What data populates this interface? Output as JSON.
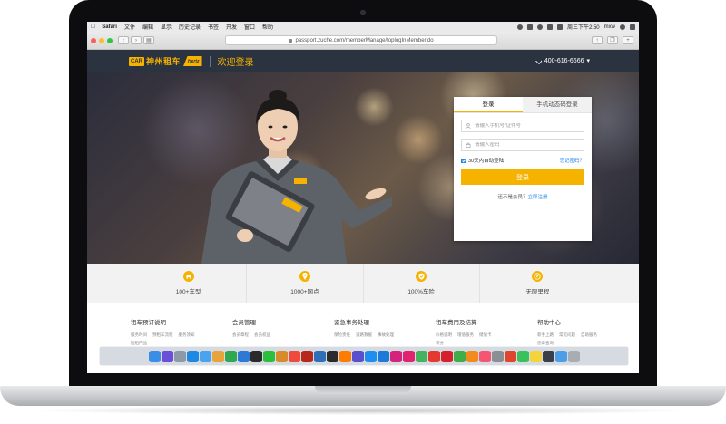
{
  "menubar": {
    "items": [
      "Safari",
      "文件",
      "编辑",
      "显示",
      "历史记录",
      "书签",
      "开发",
      "窗口",
      "帮助"
    ],
    "clock": "周三下午2:50",
    "user": "mxw"
  },
  "browser": {
    "url": "passport.zuche.com/memberManage/toplogInMember.do"
  },
  "header": {
    "logo_mark": "CAR",
    "logo_text": "神州租车",
    "logo_partner": "Hertz",
    "title": "欢迎登录",
    "phone": "400-616-6666"
  },
  "login": {
    "tab_account": "登录",
    "tab_phone": "手机动态码登录",
    "username_placeholder": "请输入手机号/证件号",
    "password_placeholder": "请输入密码",
    "remember_label": "30天内自动登陆",
    "remember_checked": true,
    "forgot_link": "忘记密码？",
    "submit_label": "登录",
    "register_prompt": "还不是会员？",
    "register_link": "立即注册"
  },
  "features": [
    {
      "icon": "car-icon",
      "label": "100+车型"
    },
    {
      "icon": "location-pin-icon",
      "label": "1000+网点"
    },
    {
      "icon": "shield-check-icon",
      "label": "100%车险"
    },
    {
      "icon": "compass-icon",
      "label": "无限里程"
    }
  ],
  "footer": [
    {
      "title": "租车预订说明",
      "links": [
        "服务时间",
        "预租车流程",
        "服务须知",
        "短租产品"
      ]
    },
    {
      "title": "会员管理",
      "links": [
        "会员章程",
        "会员权益"
      ]
    },
    {
      "title": "紧急事务处理",
      "links": [
        "保险责任",
        "道路救援",
        "事故处理"
      ]
    },
    {
      "title": "租车费用及结算",
      "links": [
        "价格说明",
        "增值服务",
        "储值卡",
        "积分"
      ]
    },
    {
      "title": "帮助中心",
      "links": [
        "新手上路",
        "常见问题",
        "自助服务",
        "违章查询"
      ]
    }
  ],
  "dock_apps": [
    {
      "name": "finder",
      "color": "#3a8ee6"
    },
    {
      "name": "siri",
      "color": "#6b4fd8"
    },
    {
      "name": "launchpad",
      "color": "#8d99a6"
    },
    {
      "name": "safari",
      "color": "#1e88e5"
    },
    {
      "name": "mail",
      "color": "#4aa3f0"
    },
    {
      "name": "photos",
      "color": "#e8a33c"
    },
    {
      "name": "numbers",
      "color": "#2fa84f"
    },
    {
      "name": "keynote",
      "color": "#2e78d6"
    },
    {
      "name": "qq",
      "color": "#2b2b2b"
    },
    {
      "name": "wechat",
      "color": "#2dbe3c"
    },
    {
      "name": "preview",
      "color": "#d98b2b"
    },
    {
      "name": "calendar",
      "color": "#f04a3a"
    },
    {
      "name": "filezilla",
      "color": "#b8261c"
    },
    {
      "name": "sourcetree",
      "color": "#2f6fb8"
    },
    {
      "name": "terminal",
      "color": "#2b2b2b"
    },
    {
      "name": "illustrator",
      "color": "#ff7c00"
    },
    {
      "name": "aftereffects",
      "color": "#5a4fcf"
    },
    {
      "name": "appstore",
      "color": "#1f8ef1"
    },
    {
      "name": "photoshop",
      "color": "#1d7ad8"
    },
    {
      "name": "xd",
      "color": "#d3237b"
    },
    {
      "name": "indesign",
      "color": "#e0226f"
    },
    {
      "name": "dreamweaver",
      "color": "#44b35e"
    },
    {
      "name": "wps",
      "color": "#e5392f"
    },
    {
      "name": "flash",
      "color": "#d6202c"
    },
    {
      "name": "maps",
      "color": "#3fae49"
    },
    {
      "name": "pages",
      "color": "#f28a1d"
    },
    {
      "name": "music",
      "color": "#f45572"
    },
    {
      "name": "settings",
      "color": "#8a8f96"
    },
    {
      "name": "chrome",
      "color": "#e0452e"
    },
    {
      "name": "messages",
      "color": "#39c25c"
    },
    {
      "name": "notes",
      "color": "#f5d33c"
    },
    {
      "name": "ps-file",
      "color": "#3a3f48"
    },
    {
      "name": "folder",
      "color": "#4a9fe8"
    },
    {
      "name": "trash",
      "color": "#a8adb3"
    }
  ],
  "colors": {
    "brand_yellow": "#f5b300",
    "header_bg": "#2b3240",
    "link_blue": "#1e88e5"
  }
}
